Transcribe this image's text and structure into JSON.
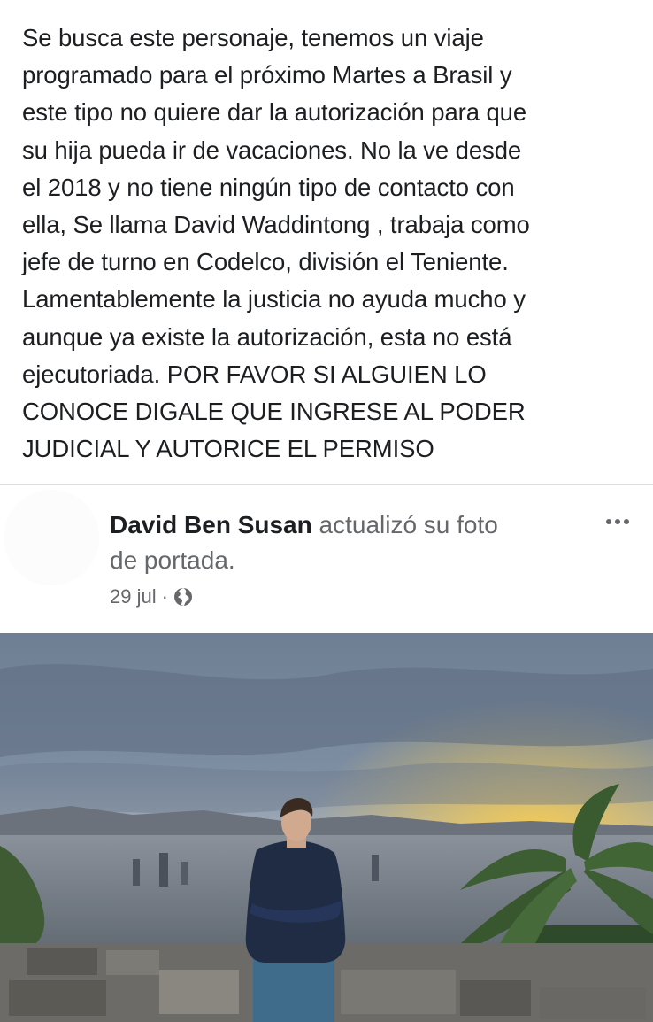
{
  "post": {
    "lines": [
      "Se busca este personaje, tenemos un viaje",
      "programado para el próximo Martes a Brasil y",
      "este tipo no quiere dar la autorización para que",
      "su hija pueda ir de vacaciones. No la ve desde",
      "el 2018 y no tiene ningún tipo de contacto con",
      "ella, Se llama David Waddintong , trabaja como",
      "jefe de turno en Codelco, división el Teniente.",
      "Lamentablemente la justicia no ayuda mucho y",
      "aunque ya existe la autorización, esta no está",
      "ejecutoriada. POR FAVOR SI ALGUIEN LO",
      "CONOCE DIGALE QUE INGRESE AL PODER",
      "JUDICIAL Y AUTORICE EL PERMISO"
    ]
  },
  "shared": {
    "author": "David Ben Susan",
    "action_line1": "actualizó su foto",
    "action_line2": "de portada.",
    "date": "29 jul",
    "separator": "·",
    "privacy_icon": "globe-icon",
    "more_icon": "more-options-icon"
  },
  "colors": {
    "text": "#1c1e21",
    "secondary": "#65676b",
    "divider": "#dcdde0"
  }
}
